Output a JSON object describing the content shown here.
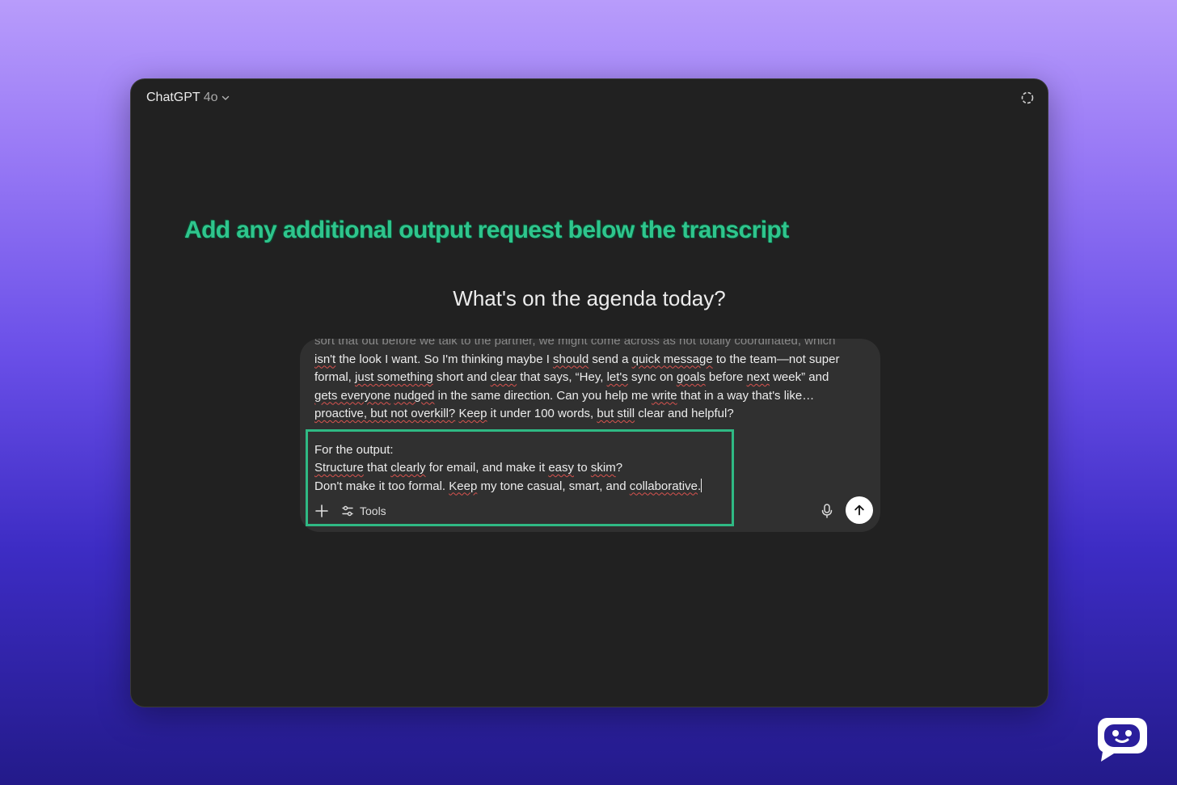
{
  "app": {
    "model_name": "ChatGPT",
    "model_version": "4o"
  },
  "callout": {
    "text": "Add any additional output request below the transcript",
    "color": "#2fc58d"
  },
  "headline": "What's on the agenda today?",
  "composer": {
    "transcript": {
      "partial_line": "sort that out before we talk to the partner, we might come across as not totally coordinated, which",
      "lines": [
        [
          "isn't",
          " the look I want. So I'm thinking maybe I ",
          "should",
          " send a ",
          "quick message",
          " to the team—not super"
        ],
        [
          "formal, ",
          "just something",
          " short and ",
          "clear",
          " that says, “Hey, ",
          "let's",
          " sync on ",
          "goals",
          " before ",
          "next",
          " week” and"
        ],
        [
          "gets everyone",
          " ",
          "nudged",
          " in the same direction. Can you help me ",
          "write",
          " that in a way that's like…"
        ],
        [
          "proactive, but not overkill?",
          " ",
          "Keep",
          " it under 100 words, ",
          "but still",
          " clear and helpful?"
        ]
      ]
    },
    "output_request": {
      "heading": "For the output:",
      "line1_a": "Structure",
      "line1_b": " that ",
      "line1_c": "clearly",
      "line1_d": " for email, and make it ",
      "line1_e": "easy",
      "line1_f": " to ",
      "line1_g": "skim",
      "line1_h": "?",
      "line2_a": "Don't make it too formal. ",
      "line2_b": "Keep",
      "line2_c": " my tone casual, smart, and ",
      "line2_d": "collaborative",
      "line2_e": "."
    },
    "tools_label": "Tools",
    "icons": {
      "plus": "plus-icon",
      "tools": "sliders-icon",
      "mic": "microphone-icon",
      "send": "arrow-up-icon",
      "temporary_chat": "dashed-circle-icon",
      "model_menu": "chevron-down-icon"
    },
    "highlight_color": "#2fb984"
  }
}
